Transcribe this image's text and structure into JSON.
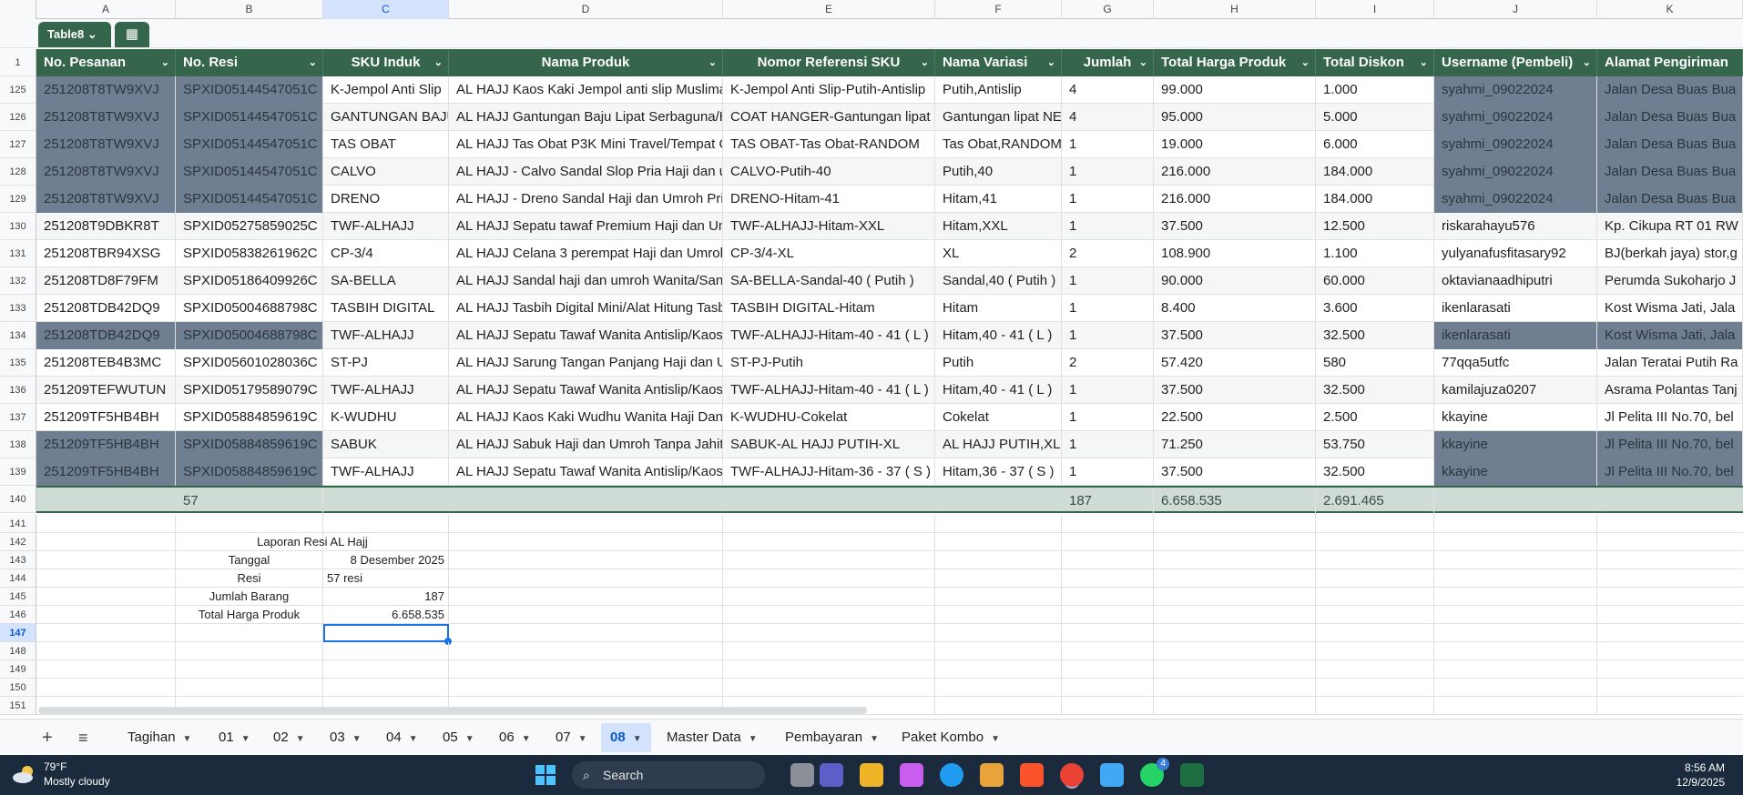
{
  "column_letters": [
    "A",
    "B",
    "C",
    "D",
    "E",
    "F",
    "G",
    "H",
    "I",
    "J",
    "K"
  ],
  "selected_column": "C",
  "table_name": "Table8",
  "headers": [
    "No. Pesanan",
    "No. Resi",
    "SKU Induk",
    "Nama Produk",
    "Nomor Referensi SKU",
    "Nama Variasi",
    "Jumlah",
    "Total Harga Produk",
    "Total Diskon",
    "Username (Pembeli)",
    "Alamat Pengiriman"
  ],
  "rows": [
    {
      "n": "125",
      "c": [
        "251208T8TW9XVJ",
        "SPXID05144547051C",
        "K-Jempol Anti Slip",
        "AL HAJJ Kaos Kaki Jempol anti slip Muslima",
        "K-Jempol Anti Slip-Putih-Antislip",
        "Putih,Antislip",
        "4",
        "99.000",
        "1.000",
        "syahmi_09022024",
        "Jalan Desa Buas Bua"
      ],
      "hl": true
    },
    {
      "n": "126",
      "c": [
        "251208T8TW9XVJ",
        "SPXID05144547051C",
        "GANTUNGAN BAJU",
        "AL HAJJ Gantungan Baju Lipat Serbaguna/H",
        "COAT HANGER-Gantungan lipat N",
        "Gantungan lipat NEW",
        "4",
        "95.000",
        "5.000",
        "syahmi_09022024",
        "Jalan Desa Buas Bua"
      ],
      "hl": true
    },
    {
      "n": "127",
      "c": [
        "251208T8TW9XVJ",
        "SPXID05144547051C",
        "TAS OBAT",
        "AL HAJJ Tas Obat P3K Mini Travel/Tempat C",
        "TAS OBAT-Tas Obat-RANDOM",
        "Tas Obat,RANDOM",
        "1",
        "19.000",
        "6.000",
        "syahmi_09022024",
        "Jalan Desa Buas Bua"
      ],
      "hl": true
    },
    {
      "n": "128",
      "c": [
        "251208T8TW9XVJ",
        "SPXID05144547051C",
        "CALVO",
        "AL HAJJ - Calvo Sandal Slop Pria Haji dan u",
        "CALVO-Putih-40",
        "Putih,40",
        "1",
        "216.000",
        "184.000",
        "syahmi_09022024",
        "Jalan Desa Buas Bua"
      ],
      "hl": true
    },
    {
      "n": "129",
      "c": [
        "251208T8TW9XVJ",
        "SPXID05144547051C",
        "DRENO",
        "AL HAJJ - Dreno Sandal Haji dan Umroh Pria",
        "DRENO-Hitam-41",
        "Hitam,41",
        "1",
        "216.000",
        "184.000",
        "syahmi_09022024",
        "Jalan Desa Buas Bua"
      ],
      "hl": true
    },
    {
      "n": "130",
      "c": [
        "251208T9DBKR8T",
        "SPXID05275859025C",
        "TWF-ALHAJJ",
        "AL HAJJ Sepatu tawaf Premium Haji dan Um",
        "TWF-ALHAJJ-Hitam-XXL",
        "Hitam,XXL",
        "1",
        "37.500",
        "12.500",
        "riskarahayu576",
        "Kp. Cikupa RT 01 RW"
      ],
      "hl": false
    },
    {
      "n": "131",
      "c": [
        "251208TBR94XSG",
        "SPXID05838261962C",
        "CP-3/4",
        "AL HAJJ Celana 3 perempat Haji dan Umroh",
        "CP-3/4-XL",
        "XL",
        "2",
        "108.900",
        "1.100",
        "yulyanafusfitasary92",
        "BJ(berkah jaya) stor,g"
      ],
      "hl": false
    },
    {
      "n": "132",
      "c": [
        "251208TD8F79FM",
        "SPXID05186409926C",
        "SA-BELLA",
        "AL HAJJ Sandal haji dan umroh Wanita/Sand",
        "SA-BELLA-Sandal-40 ( Putih )",
        "Sandal,40 ( Putih )",
        "1",
        "90.000",
        "60.000",
        "oktavianaadhiputri",
        "Perumda Sukoharjo J"
      ],
      "hl": false
    },
    {
      "n": "133",
      "c": [
        "251208TDB42DQ9",
        "SPXID05004688798C",
        "TASBIH DIGITAL",
        "AL HAJJ Tasbih Digital Mini/Alat Hitung Tasbi",
        "TASBIH DIGITAL-Hitam",
        "Hitam",
        "1",
        "8.400",
        "3.600",
        "ikenlarasati",
        "Kost Wisma Jati, Jala"
      ],
      "hl": false
    },
    {
      "n": "134",
      "c": [
        "251208TDB42DQ9",
        "SPXID05004688798C",
        "TWF-ALHAJJ",
        "AL HAJJ Sepatu Tawaf Wanita Antislip/Kaos",
        "TWF-ALHAJJ-Hitam-40 - 41 ( L )",
        "Hitam,40 - 41 ( L )",
        "1",
        "37.500",
        "32.500",
        "ikenlarasati",
        "Kost Wisma Jati, Jala"
      ],
      "hl": true
    },
    {
      "n": "135",
      "c": [
        "251208TEB4B3MC",
        "SPXID05601028036C",
        "ST-PJ",
        "AL HAJJ Sarung Tangan Panjang Haji dan U",
        "ST-PJ-Putih",
        "Putih",
        "2",
        "57.420",
        "580",
        "77qqa5utfc",
        "Jalan Teratai Putih Ra"
      ],
      "hl": false
    },
    {
      "n": "136",
      "c": [
        "251209TEFWUTUN",
        "SPXID05179589079C",
        "TWF-ALHAJJ",
        "AL HAJJ Sepatu Tawaf Wanita Antislip/Kaos",
        "TWF-ALHAJJ-Hitam-40 - 41 ( L )",
        "Hitam,40 - 41 ( L )",
        "1",
        "37.500",
        "32.500",
        "kamilajuza0207",
        "Asrama Polantas Tanj"
      ],
      "hl": false
    },
    {
      "n": "137",
      "c": [
        "251209TF5HB4BH",
        "SPXID05884859619C",
        "K-WUDHU",
        "AL HAJJ Kaos Kaki Wudhu Wanita Haji Dan",
        "K-WUDHU-Cokelat",
        "Cokelat",
        "1",
        "22.500",
        "2.500",
        "kkayine",
        "Jl Pelita III No.70, bel"
      ],
      "hl": false
    },
    {
      "n": "138",
      "c": [
        "251209TF5HB4BH",
        "SPXID05884859619C",
        "SABUK",
        "AL HAJJ Sabuk Haji dan Umroh Tanpa Jahit",
        "SABUK-AL HAJJ PUTIH-XL",
        "AL HAJJ PUTIH,XL",
        "1",
        "71.250",
        "53.750",
        "kkayine",
        "Jl Pelita III No.70, bel"
      ],
      "hl": true
    },
    {
      "n": "139",
      "c": [
        "251209TF5HB4BH",
        "SPXID05884859619C",
        "TWF-ALHAJJ",
        "AL HAJJ Sepatu Tawaf Wanita Antislip/Kaos",
        "TWF-ALHAJJ-Hitam-36 - 37 ( S )",
        "Hitam,36 - 37 ( S )",
        "1",
        "37.500",
        "32.500",
        "kkayine",
        "Jl Pelita III No.70, bel"
      ],
      "hl": true
    }
  ],
  "total_row": {
    "n": "140",
    "resi": "57",
    "jumlah": "187",
    "total_harga": "6.658.535",
    "total_diskon": "2.691.465"
  },
  "summary": {
    "title": "Laporan Resi AL Hajj",
    "rows": [
      {
        "n": "143",
        "label": "Tanggal",
        "value": "8 Desember 2025"
      },
      {
        "n": "144",
        "label": "Resi",
        "value": "57 resi"
      },
      {
        "n": "145",
        "label": "Jumlah Barang",
        "value": "187"
      },
      {
        "n": "146",
        "label": "Total Harga Produk",
        "value": "6.658.535"
      }
    ]
  },
  "empty_rows": [
    "141",
    "147",
    "148",
    "149",
    "150",
    "151"
  ],
  "title_row": "142",
  "header_row_num": "1",
  "sheet_tabs": [
    "Tagihan",
    "01",
    "02",
    "03",
    "04",
    "05",
    "06",
    "07",
    "08",
    "Master Data",
    "Pembayaran",
    "Paket Kombo"
  ],
  "active_tab": "08",
  "taskbar": {
    "temp": "79°F",
    "weather": "Mostly cloudy",
    "search": "Search",
    "time": "8:56 AM",
    "date": "12/9/2025",
    "whatsapp_badge": "4"
  },
  "colors": {
    "header_green": "#35654b",
    "highlight": "#6f7f91",
    "total_row": "#cfdcd5",
    "selection": "#1a73e8"
  }
}
